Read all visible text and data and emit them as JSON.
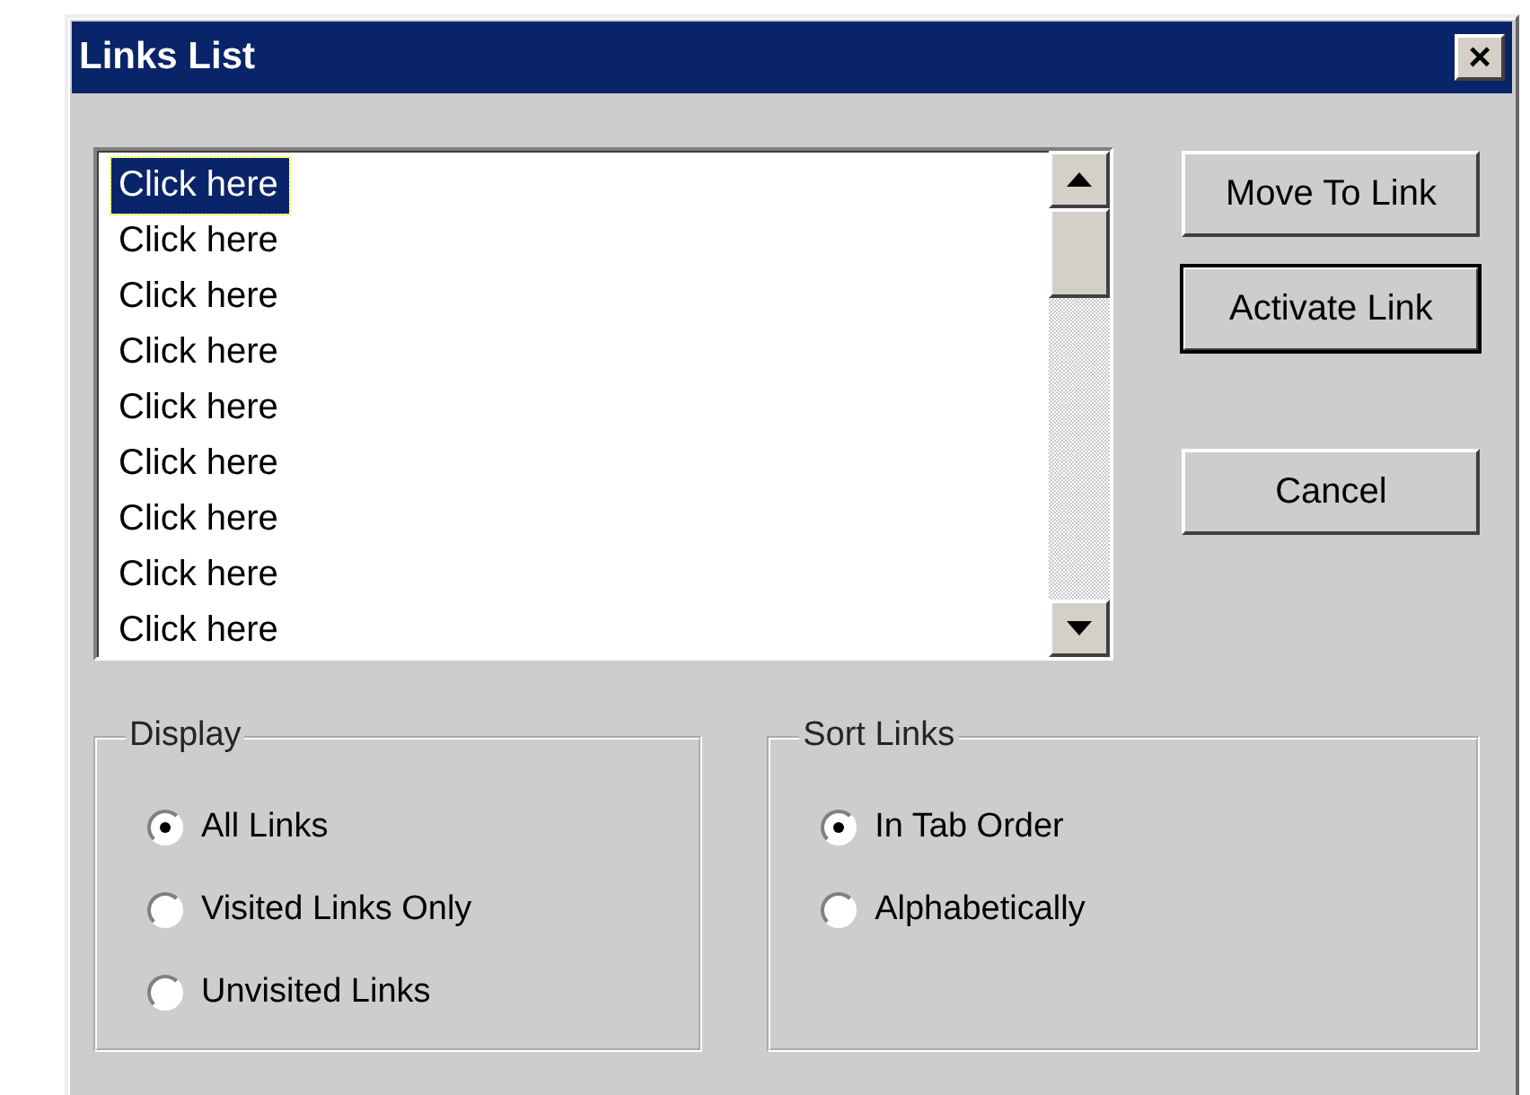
{
  "window": {
    "title": "Links List",
    "close": "×"
  },
  "links_list": {
    "items": [
      {
        "label": "Click here",
        "selected": true
      },
      {
        "label": "Click here",
        "selected": false
      },
      {
        "label": "Click here",
        "selected": false
      },
      {
        "label": "Click here",
        "selected": false
      },
      {
        "label": "Click here",
        "selected": false
      },
      {
        "label": "Click here",
        "selected": false
      },
      {
        "label": "Click here",
        "selected": false
      },
      {
        "label": "Click here",
        "selected": false
      },
      {
        "label": "Click here",
        "selected": false
      }
    ]
  },
  "buttons": [
    {
      "label": "Move To Link",
      "default": false
    },
    {
      "label": "Activate Link",
      "default": true
    },
    {
      "label": "Cancel",
      "default": false
    }
  ],
  "groups": [
    {
      "title": "Display",
      "options": [
        {
          "label": "All Links",
          "selected": true
        },
        {
          "label": "Visited Links Only",
          "selected": false
        },
        {
          "label": "Unvisited Links",
          "selected": false
        }
      ]
    },
    {
      "title": "Sort Links",
      "options": [
        {
          "label": "In Tab Order",
          "selected": true
        },
        {
          "label": "Alphabetically",
          "selected": false
        }
      ]
    }
  ]
}
